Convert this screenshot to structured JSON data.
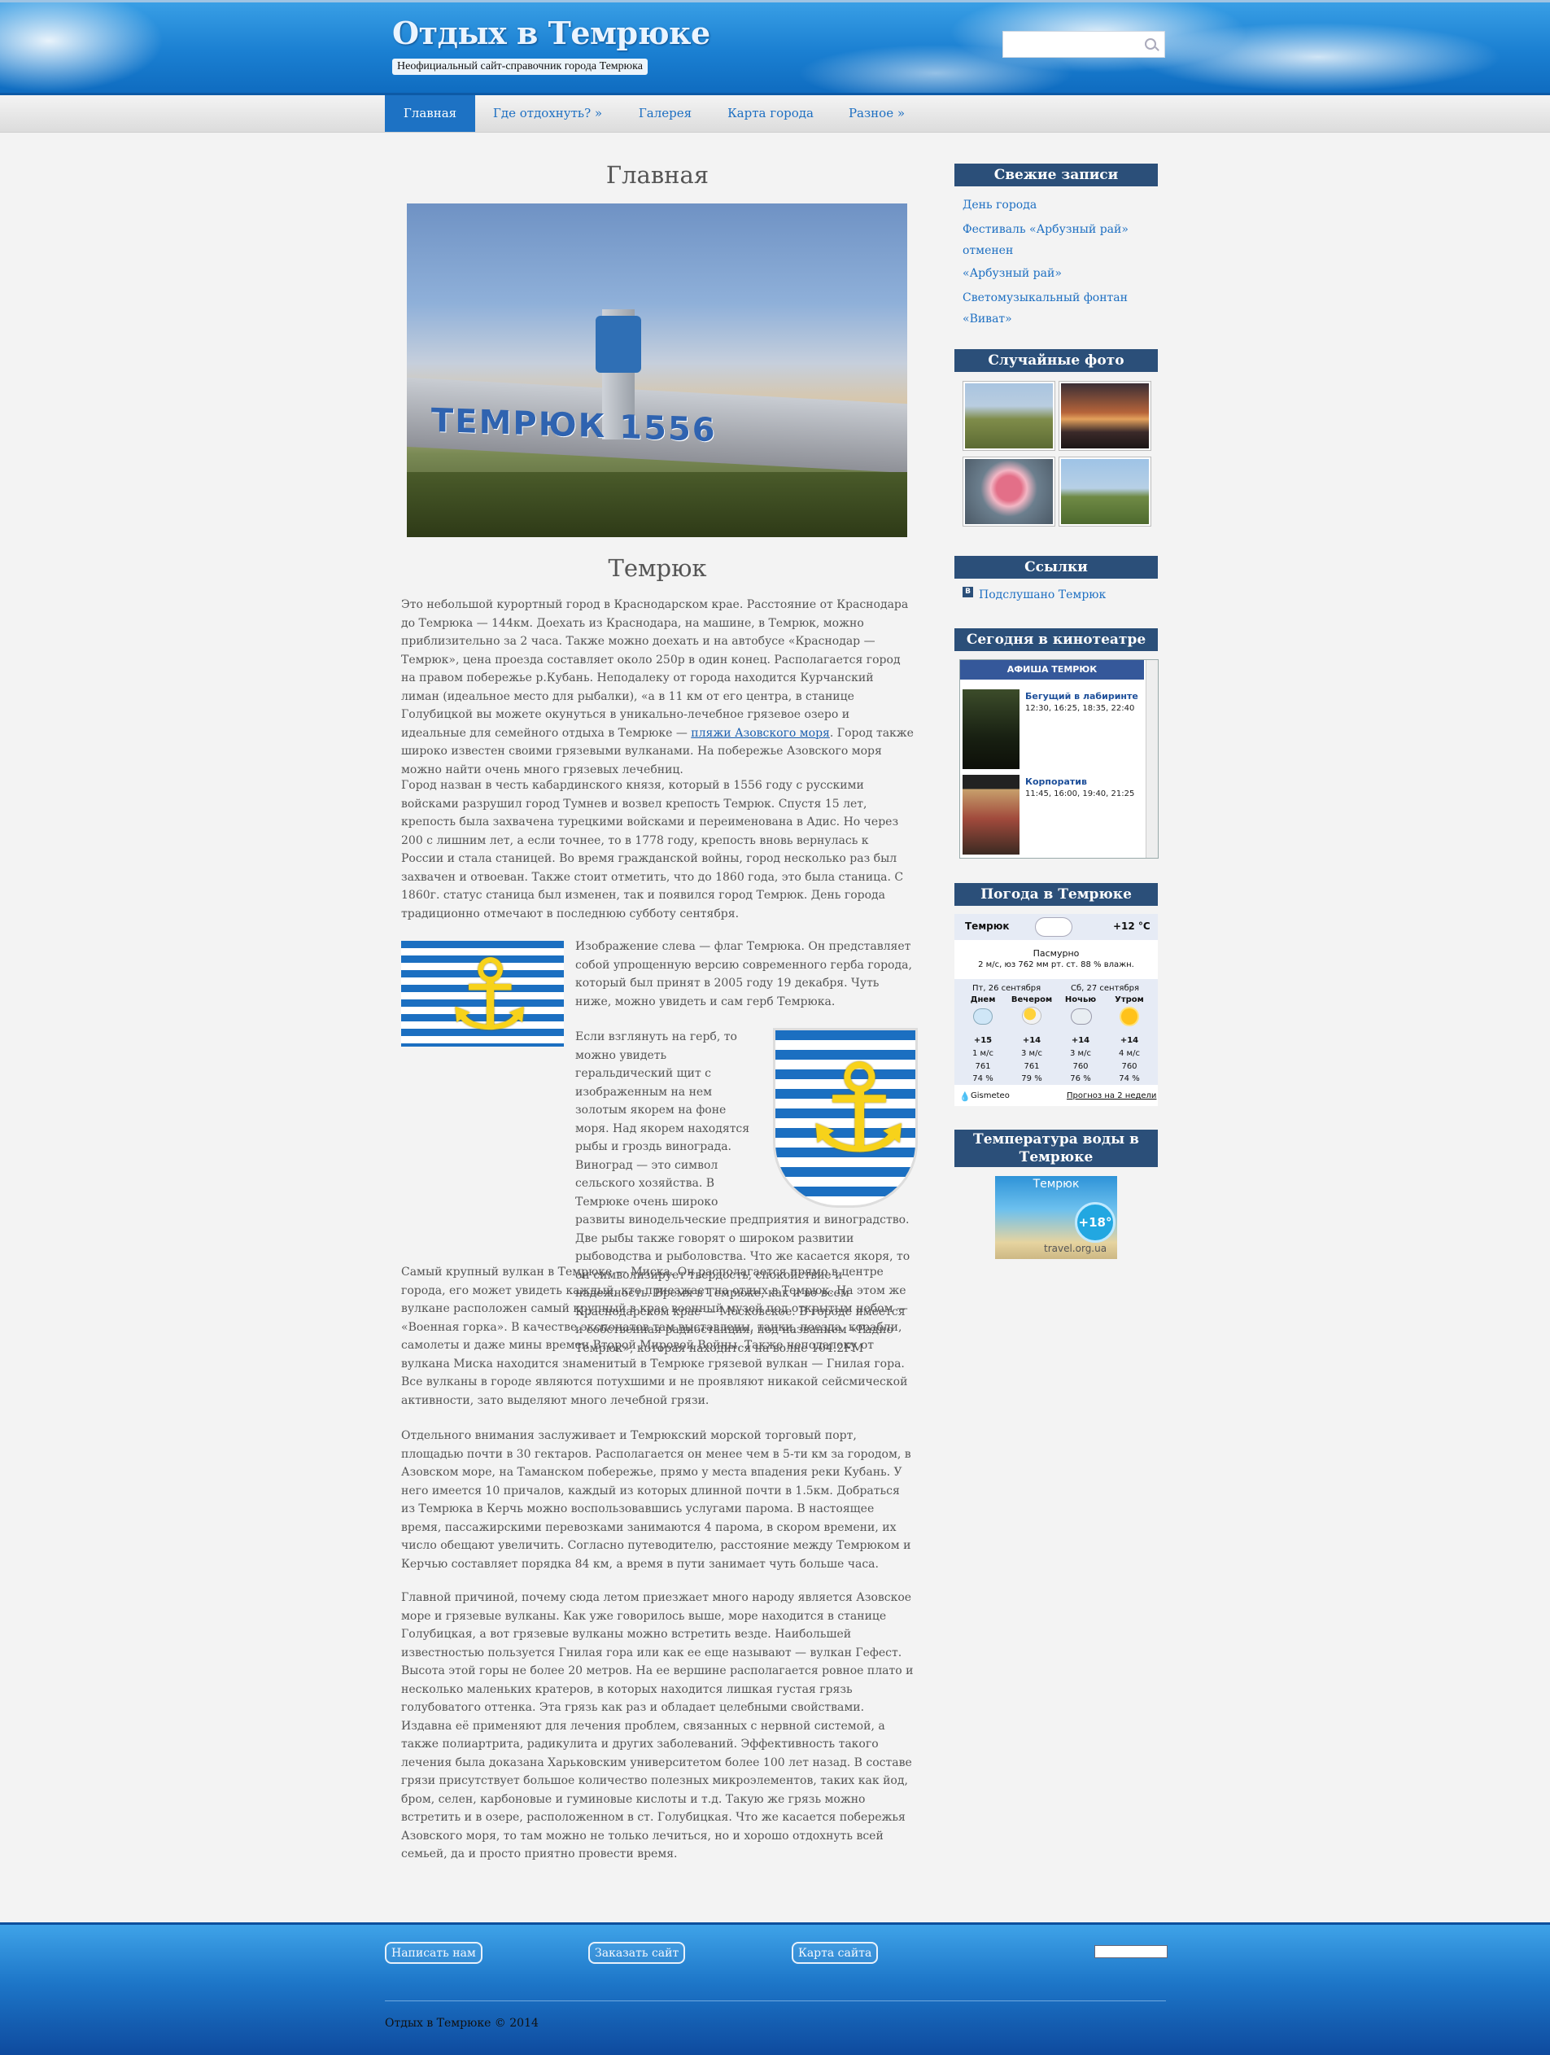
{
  "header": {
    "site_title": "Отдых в Темрюке",
    "site_description": "Неофициальный сайт-справочник города Темрюка",
    "search_placeholder": ""
  },
  "nav": [
    {
      "label": "Главная",
      "active": true
    },
    {
      "label": "Где отдохнуть? »"
    },
    {
      "label": "Галерея"
    },
    {
      "label": "Карта города"
    },
    {
      "label": "Разное »"
    }
  ],
  "main": {
    "page_title": "Главная",
    "photo_sign": "ТЕМРЮК 1556",
    "section_title": "Темрюк",
    "p1_before_link": "Это небольшой курортный город в Краснодарском крае. Расстояние от Краснодара до Темрюка — 144км. Доехать из Краснодара, на машине, в Темрюк, можно приблизительно за 2 часа. Также можно доехать и на автобусе «Краснодар — Темрюк», цена проезда составляет около 250р в один конец. Располагается город на правом побережье р.Кубань. Неподалеку от города находится Курчанский лиман (идеальное место для рыбалки), «а в 11 км от его центра, в станице Голубицкой вы можете окунуться в уникально-лечебное грязевое озеро и идеальные для семейного отдыха в Темрюке — ",
    "p1_link": "пляжи Азовского моря",
    "p1_after_link": ". Город также широко известен своими грязевыми вулканами. На побережье Азовского моря можно найти очень много грязевых лечебниц.",
    "p2": "Город назван в честь кабардинского князя, который в 1556 году с русскими войсками разрушил город Тумнев и возвел крепость Темрюк. Спустя 15 лет, крепость была захвачена турецкими войсками и переименована в Адис. Но через 200 с лишним лет, а если точнее, то в 1778 году, крепость вновь вернулась к России и стала станицей. Во время гражданской войны, город несколько раз был захвачен и отвоеван. Также стоит отметить, что до 1860 года, это была станица. С 1860г. статус станица был изменен, так и появился город Темрюк. День города традиционно отмечают в последнюю субботу сентября.",
    "flag_text": "Изображение слева — флаг Темрюка. Он представляет собой упрощенную версию современного герба города, который был принят в 2005 году 19 декабря. Чуть ниже, можно увидеть и сам герб Темрюка.",
    "coat_text": "Если взглянуть на герб, то можно увидеть геральдический щит с изображенным на нем золотым якорем на фоне моря. Над якорем находятся рыбы и гроздь винограда. Виноград — это символ сельского хозяйства. В Темрюке очень широко развиты винодельческие предприятия и виноградство. Две рыбы также говорят о широком развитии рыбоводства и рыболовства. Что же касается якоря, то он символизирует твердость, спокойствие и надежность. Время в Темрюке, как и во всем Краснодарском крае — Московское. В городе имеется и собственная радиостанция, под названием «Радио Темрюк», которая находится на волне 104.2FM",
    "p4": "Самый крупный вулкан в Темрюке — Миска. Он располагается прямо в центре города, его может увидеть каждый, кто приезжает на отдых в Темрюк. На этом же вулкане расположен самый крупный в крае военный музей под открытым небом — «Военная горка». В качестве экспонатов там выставлены, танки, поезда, корабли, самолеты и даже мины времен Второй Мировой Войны. Также неподалеку от вулкана Миска находится знаменитый в Темрюке грязевой вулкан — Гнилая гора. Все вулканы в городе являются потухшими и не проявляют никакой сейсмической активности, зато выделяют много лечебной грязи.",
    "p5": "Отдельного внимания заслуживает и Темрюкский морской торговый порт, площадью почти в 30 гектаров. Располагается он менее чем в 5-ти км за городом, в Азовском море, на Таманском побережье, прямо у места впадения реки Кубань. У него имеется 10 причалов, каждый из которых длинной почти в 1.5км. Добраться из Темрюка в Керчь можно воспользовавшись услугами парома. В настоящее время, пассажирскими перевозками занимаются 4 парома, в скором времени, их число обещают увеличить. Согласно путеводителю, расстояние между Темрюком и Керчью составляет порядка 84 км, а время в пути занимает чуть больше часа.",
    "p6": "Главной причиной, почему сюда летом приезжает много народу является Азовское море и грязевые вулканы. Как уже говорилось выше, море находится в станице Голубицкая, а вот грязевые вулканы можно встретить везде. Наибольшей известностью пользуется Гнилая гора или как ее еще называют — вулкан Гефест. Высота этой горы не более 20 метров. На ее вершине располагается ровное плато и несколько маленьких кратеров, в которых находится лишкая густая грязь голубоватого оттенка. Эта грязь как раз и обладает целебными свойствами. Издавна её применяют для лечения проблем, связанных с нервной системой, а также полиартрита, радикулита и других заболеваний. Эффективность такого лечения была доказана Харьковским университетом более 100 лет назад. В составе грязи присутствует большое количество полезных микроэлементов, таких как йод, бром, селен, карбоновые и гуминовые кислоты и т.д. Такую же грязь можно встретить и в озере, расположенном в ст. Голубицкая. Что же касается побережья Азовского моря, то там можно не только лечиться, но и хорошо отдохнуть всей семьей, да и просто приятно провести время."
  },
  "sidebar": {
    "recent_title": "Свежие записи",
    "recent": [
      "День города",
      "Фестиваль «Арбузный рай» отменен",
      "«Арбузный рай»",
      "Светомузыкальный фонтан «Виват»"
    ],
    "photos_title": "Случайные фото",
    "links_title": "Ссылки",
    "links": [
      "Подслушано Темрюк"
    ],
    "cinema_title": "Сегодня в кинотеатре",
    "cinema": {
      "header": "АФИША ТЕМРЮК",
      "movies": [
        {
          "title": "Бегущий в лабиринте",
          "times": "12:30, 16:25, 18:35, 22:40"
        },
        {
          "title": "Корпоратив",
          "times": "11:45, 16:00, 19:40, 21:25"
        }
      ]
    },
    "weather_title": "Погода в Темрюке",
    "weather": {
      "city": "Темрюк",
      "temp_now": "+12 °C",
      "condition": "Пасмурно",
      "details": "2 м/с, юз   762 мм рт. ст.   88 % влажн.",
      "date1": "Пт, 26 сентября",
      "date2": "Сб, 27 сентября",
      "periods": [
        {
          "label": "Днем",
          "temp": "+15",
          "wind": "1 м/с",
          "pressure": "761",
          "humidity": "74 %"
        },
        {
          "label": "Вечером",
          "temp": "+14",
          "wind": "3 м/с",
          "pressure": "761",
          "humidity": "79 %"
        },
        {
          "label": "Ночью",
          "temp": "+14",
          "wind": "3 м/с",
          "pressure": "760",
          "humidity": "76 %"
        },
        {
          "label": "Утром",
          "temp": "+14",
          "wind": "4 м/с",
          "pressure": "760",
          "humidity": "74 %"
        }
      ],
      "provider": "Gismeteo",
      "forecast_link": "Прогноз на 2 недели"
    },
    "water_title": "Температура воды в Темрюке",
    "water": {
      "city": "Темрюк",
      "temp": "+18°",
      "site": "travel.org.ua"
    }
  },
  "footer": {
    "buttons": [
      "Написать нам",
      "Заказать сайт",
      "Карта сайта"
    ],
    "copyright": "Отдых в Темрюке © 2014"
  }
}
